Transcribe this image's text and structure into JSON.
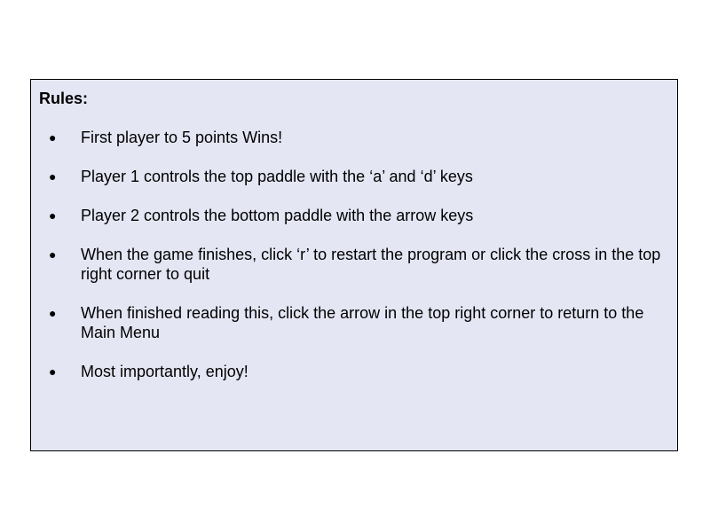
{
  "rules": {
    "title": "Rules:",
    "bullet_glyph": "●",
    "items": [
      "First player to 5 points Wins!",
      "Player 1 controls the top paddle with the ‘a’ and ‘d’ keys",
      "Player 2 controls the bottom paddle with the arrow keys",
      "When the game finishes, click ‘r’ to restart the program or click the cross in the top right corner to quit",
      "When finished reading this, click the arrow in the top right corner to return to the Main Menu",
      "Most importantly, enjoy!"
    ]
  },
  "colors": {
    "panel_background": "#e4e6f4",
    "panel_border": "#000000",
    "page_background": "#ffffff",
    "text": "#000000"
  }
}
